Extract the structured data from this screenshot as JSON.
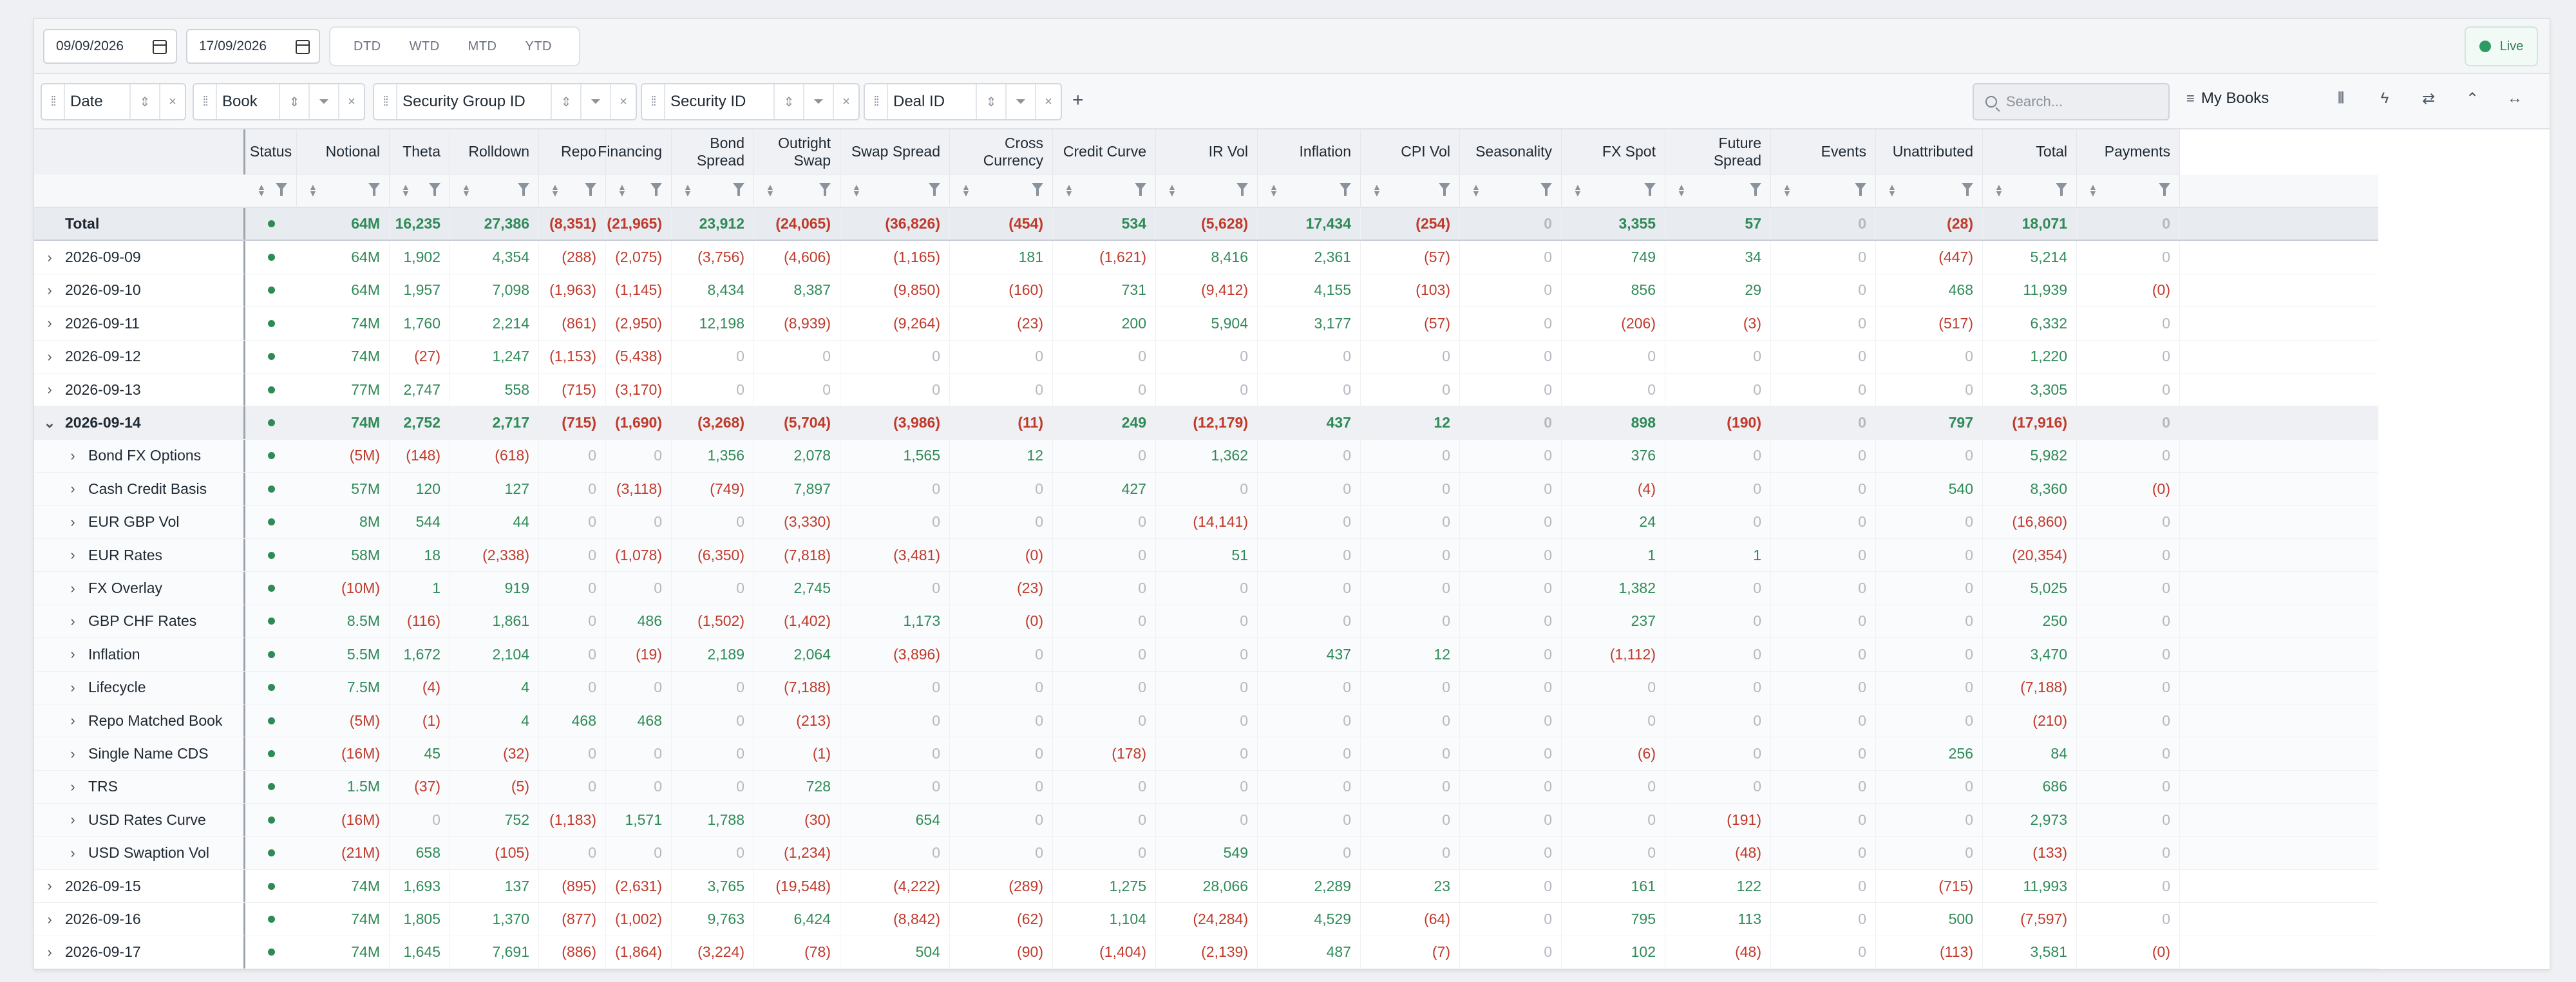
{
  "toolbar": {
    "date_from": "09/09/2026",
    "date_to": "17/09/2026",
    "periods": [
      "DTD",
      "WTD",
      "MTD",
      "YTD"
    ],
    "live_label": "Live",
    "live_color": "#2f9a63"
  },
  "groupbar": {
    "chips": [
      "Date",
      "Book",
      "Security Group ID",
      "Security ID",
      "Deal ID"
    ],
    "add_symbol": "+",
    "search_placeholder": "Search...",
    "my_books_label": "My Books"
  },
  "columns": [
    "Status",
    "Notional",
    "Theta",
    "Rolldown",
    "Repo",
    "Financing",
    "Bond Spread",
    "Outright Swap",
    "Swap Spread",
    "Cross Currency",
    "Credit Curve",
    "IR Vol",
    "Inflation",
    "CPI Vol",
    "Seasonality",
    "FX Spot",
    "Future Spread",
    "Events",
    "Unattributed",
    "Total",
    "Payments"
  ],
  "rows": [
    {
      "name": "Total",
      "kind": "total",
      "values": [
        "64M",
        "16,235",
        "27,386",
        "(8,351)",
        "(21,965)",
        "23,912",
        "(24,065)",
        "(36,826)",
        "(454)",
        "534",
        "(5,628)",
        "17,434",
        "(254)",
        "0",
        "3,355",
        "57",
        "0",
        "(28)",
        "18,071",
        "0"
      ]
    },
    {
      "name": "2026-09-09",
      "kind": "date",
      "values": [
        "64M",
        "1,902",
        "4,354",
        "(288)",
        "(2,075)",
        "(3,756)",
        "(4,606)",
        "(1,165)",
        "181",
        "(1,621)",
        "8,416",
        "2,361",
        "(57)",
        "0",
        "749",
        "34",
        "0",
        "(447)",
        "5,214",
        "0"
      ]
    },
    {
      "name": "2026-09-10",
      "kind": "date",
      "values": [
        "64M",
        "1,957",
        "7,098",
        "(1,963)",
        "(1,145)",
        "8,434",
        "8,387",
        "(9,850)",
        "(160)",
        "731",
        "(9,412)",
        "4,155",
        "(103)",
        "0",
        "856",
        "29",
        "0",
        "468",
        "11,939",
        "(0)"
      ]
    },
    {
      "name": "2026-09-11",
      "kind": "date",
      "values": [
        "74M",
        "1,760",
        "2,214",
        "(861)",
        "(2,950)",
        "12,198",
        "(8,939)",
        "(9,264)",
        "(23)",
        "200",
        "5,904",
        "3,177",
        "(57)",
        "0",
        "(206)",
        "(3)",
        "0",
        "(517)",
        "6,332",
        "0"
      ]
    },
    {
      "name": "2026-09-12",
      "kind": "date",
      "values": [
        "74M",
        "(27)",
        "1,247",
        "(1,153)",
        "(5,438)",
        "0",
        "0",
        "0",
        "0",
        "0",
        "0",
        "0",
        "0",
        "0",
        "0",
        "0",
        "0",
        "0",
        "1,220",
        "0"
      ]
    },
    {
      "name": "2026-09-13",
      "kind": "date",
      "values": [
        "77M",
        "2,747",
        "558",
        "(715)",
        "(3,170)",
        "0",
        "0",
        "0",
        "0",
        "0",
        "0",
        "0",
        "0",
        "0",
        "0",
        "0",
        "0",
        "0",
        "3,305",
        "0"
      ]
    },
    {
      "name": "2026-09-14",
      "kind": "expanded",
      "values": [
        "74M",
        "2,752",
        "2,717",
        "(715)",
        "(1,690)",
        "(3,268)",
        "(5,704)",
        "(3,986)",
        "(11)",
        "249",
        "(12,179)",
        "437",
        "12",
        "0",
        "898",
        "(190)",
        "0",
        "797",
        "(17,916)",
        "0"
      ]
    },
    {
      "name": "Bond FX Options",
      "kind": "child",
      "values": [
        "(5M)",
        "(148)",
        "(618)",
        "0",
        "0",
        "1,356",
        "2,078",
        "1,565",
        "12",
        "0",
        "1,362",
        "0",
        "0",
        "0",
        "376",
        "0",
        "0",
        "0",
        "5,982",
        "0"
      ]
    },
    {
      "name": "Cash Credit Basis",
      "kind": "child",
      "values": [
        "57M",
        "120",
        "127",
        "0",
        "(3,118)",
        "(749)",
        "7,897",
        "0",
        "0",
        "427",
        "0",
        "0",
        "0",
        "0",
        "(4)",
        "0",
        "0",
        "540",
        "8,360",
        "(0)"
      ]
    },
    {
      "name": "EUR GBP Vol",
      "kind": "child",
      "values": [
        "8M",
        "544",
        "44",
        "0",
        "0",
        "0",
        "(3,330)",
        "0",
        "0",
        "0",
        "(14,141)",
        "0",
        "0",
        "0",
        "24",
        "0",
        "0",
        "0",
        "(16,860)",
        "0"
      ]
    },
    {
      "name": "EUR Rates",
      "kind": "child",
      "values": [
        "58M",
        "18",
        "(2,338)",
        "0",
        "(1,078)",
        "(6,350)",
        "(7,818)",
        "(3,481)",
        "(0)",
        "0",
        "51",
        "0",
        "0",
        "0",
        "1",
        "1",
        "0",
        "0",
        "(20,354)",
        "0"
      ]
    },
    {
      "name": "FX Overlay",
      "kind": "child",
      "values": [
        "(10M)",
        "1",
        "919",
        "0",
        "0",
        "0",
        "2,745",
        "0",
        "(23)",
        "0",
        "0",
        "0",
        "0",
        "0",
        "1,382",
        "0",
        "0",
        "0",
        "5,025",
        "0"
      ]
    },
    {
      "name": "GBP CHF Rates",
      "kind": "child",
      "values": [
        "8.5M",
        "(116)",
        "1,861",
        "0",
        "486",
        "(1,502)",
        "(1,402)",
        "1,173",
        "(0)",
        "0",
        "0",
        "0",
        "0",
        "0",
        "237",
        "0",
        "0",
        "0",
        "250",
        "0"
      ]
    },
    {
      "name": "Inflation",
      "kind": "child",
      "values": [
        "5.5M",
        "1,672",
        "2,104",
        "0",
        "(19)",
        "2,189",
        "2,064",
        "(3,896)",
        "0",
        "0",
        "0",
        "437",
        "12",
        "0",
        "(1,112)",
        "0",
        "0",
        "0",
        "3,470",
        "0"
      ]
    },
    {
      "name": "Lifecycle",
      "kind": "child",
      "values": [
        "7.5M",
        "(4)",
        "4",
        "0",
        "0",
        "0",
        "(7,188)",
        "0",
        "0",
        "0",
        "0",
        "0",
        "0",
        "0",
        "0",
        "0",
        "0",
        "0",
        "(7,188)",
        "0"
      ]
    },
    {
      "name": "Repo Matched Book",
      "kind": "child",
      "values": [
        "(5M)",
        "(1)",
        "4",
        "468",
        "468",
        "0",
        "(213)",
        "0",
        "0",
        "0",
        "0",
        "0",
        "0",
        "0",
        "0",
        "0",
        "0",
        "0",
        "(210)",
        "0"
      ]
    },
    {
      "name": "Single Name CDS",
      "kind": "child",
      "values": [
        "(16M)",
        "45",
        "(32)",
        "0",
        "0",
        "0",
        "(1)",
        "0",
        "0",
        "(178)",
        "0",
        "0",
        "0",
        "0",
        "(6)",
        "0",
        "0",
        "256",
        "84",
        "0"
      ]
    },
    {
      "name": "TRS",
      "kind": "child",
      "values": [
        "1.5M",
        "(37)",
        "(5)",
        "0",
        "0",
        "0",
        "728",
        "0",
        "0",
        "0",
        "0",
        "0",
        "0",
        "0",
        "0",
        "0",
        "0",
        "0",
        "686",
        "0"
      ]
    },
    {
      "name": "USD Rates Curve",
      "kind": "child",
      "values": [
        "(16M)",
        "0",
        "752",
        "(1,183)",
        "1,571",
        "1,788",
        "(30)",
        "654",
        "0",
        "0",
        "0",
        "0",
        "0",
        "0",
        "0",
        "(191)",
        "0",
        "0",
        "2,973",
        "0"
      ]
    },
    {
      "name": "USD Swaption Vol",
      "kind": "child",
      "values": [
        "(21M)",
        "658",
        "(105)",
        "0",
        "0",
        "0",
        "(1,234)",
        "0",
        "0",
        "0",
        "549",
        "0",
        "0",
        "0",
        "0",
        "(48)",
        "0",
        "0",
        "(133)",
        "0"
      ]
    },
    {
      "name": "2026-09-15",
      "kind": "date",
      "values": [
        "74M",
        "1,693",
        "137",
        "(895)",
        "(2,631)",
        "3,765",
        "(19,548)",
        "(4,222)",
        "(289)",
        "1,275",
        "28,066",
        "2,289",
        "23",
        "0",
        "161",
        "122",
        "0",
        "(715)",
        "11,993",
        "0"
      ]
    },
    {
      "name": "2026-09-16",
      "kind": "date",
      "values": [
        "74M",
        "1,805",
        "1,370",
        "(877)",
        "(1,002)",
        "9,763",
        "6,424",
        "(8,842)",
        "(62)",
        "1,104",
        "(24,284)",
        "4,529",
        "(64)",
        "0",
        "795",
        "113",
        "0",
        "500",
        "(7,597)",
        "0"
      ]
    },
    {
      "name": "2026-09-17",
      "kind": "date",
      "values": [
        "74M",
        "1,645",
        "7,691",
        "(886)",
        "(1,864)",
        "(3,224)",
        "(78)",
        "504",
        "(90)",
        "(1,404)",
        "(2,139)",
        "487",
        "(7)",
        "0",
        "102",
        "(48)",
        "0",
        "(113)",
        "3,581",
        "(0)"
      ]
    }
  ]
}
